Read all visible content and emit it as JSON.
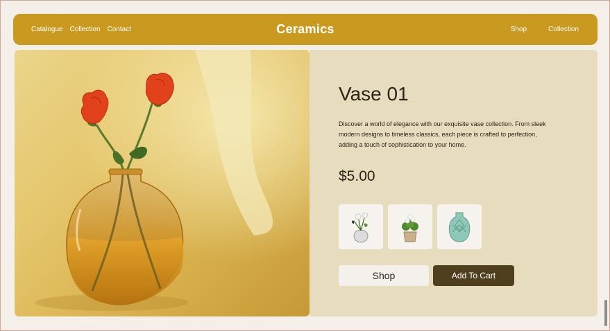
{
  "nav": {
    "left_links": [
      "Catalogue",
      "Collection",
      "Contact"
    ],
    "brand": "Ceramics",
    "right_links": [
      "Shop",
      "Collection"
    ]
  },
  "product": {
    "title": "Vase 01",
    "description": "Discover a world of elegance with our exquisite vase collection. From sleek modern designs to timeless classics, each piece is crafted to perfection, adding a touch of sophistication to your home.",
    "price": "$5.00",
    "thumbnails": [
      "flower-vase-thumbnail",
      "potted-flower-thumbnail",
      "teal-vase-thumbnail"
    ]
  },
  "buttons": {
    "shop": "Shop",
    "add_to_cart": "Add To Cart"
  },
  "colors": {
    "nav_bg": "#c99a1f",
    "detail_bg": "#e8dcbf",
    "cart_btn": "#503f1f",
    "page_bg": "#f4efe9"
  }
}
